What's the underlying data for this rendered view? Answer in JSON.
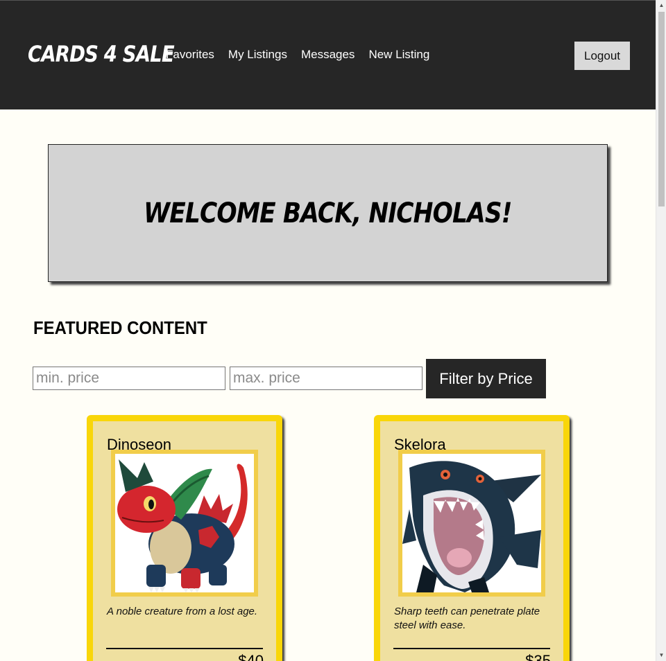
{
  "header": {
    "brand": "CARDS 4 SALE",
    "nav": [
      "Favorites",
      "My Listings",
      "Messages",
      "New Listing"
    ],
    "logout_label": "Logout"
  },
  "welcome": {
    "message": "Welcome back, Nicholas!"
  },
  "featured": {
    "title": "FEATURED CONTENT"
  },
  "filter": {
    "min_placeholder": "min. price",
    "max_placeholder": "max. price",
    "button_label": "Filter by Price"
  },
  "cards": [
    {
      "name": "Dinoseon",
      "description": "A noble creature from a lost age.",
      "price": "$40",
      "image_icon": "dinoseon-creature-icon"
    },
    {
      "name": "Skelora",
      "description": "Sharp teeth can penetrate plate steel with ease.",
      "price": "$35",
      "image_icon": "skelora-creature-icon"
    }
  ],
  "colors": {
    "header_bg": "#262626",
    "page_bg": "#fffef7",
    "card_border": "#f9d609",
    "card_bg": "#efe0a0",
    "welcome_bg": "#d3d3d3"
  }
}
